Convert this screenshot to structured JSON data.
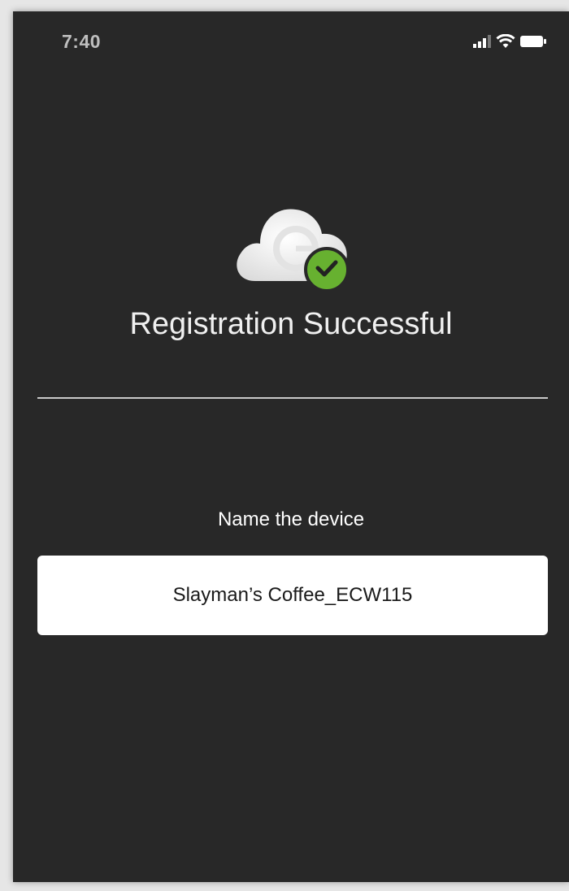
{
  "status_bar": {
    "time": "7:40",
    "icons": [
      "signal-icon",
      "wifi-icon",
      "battery-icon"
    ]
  },
  "hero": {
    "logo_icon": "cloud-logo-icon",
    "badge_icon": "checkmark-icon",
    "badge_color": "#67b130"
  },
  "title": "Registration Successful",
  "device_name": {
    "label": "Name the device",
    "value": "Slayman’s Coffee_ECW115"
  },
  "colors": {
    "background": "#282828",
    "accent": "#67b130",
    "field_background": "#ffffff"
  }
}
